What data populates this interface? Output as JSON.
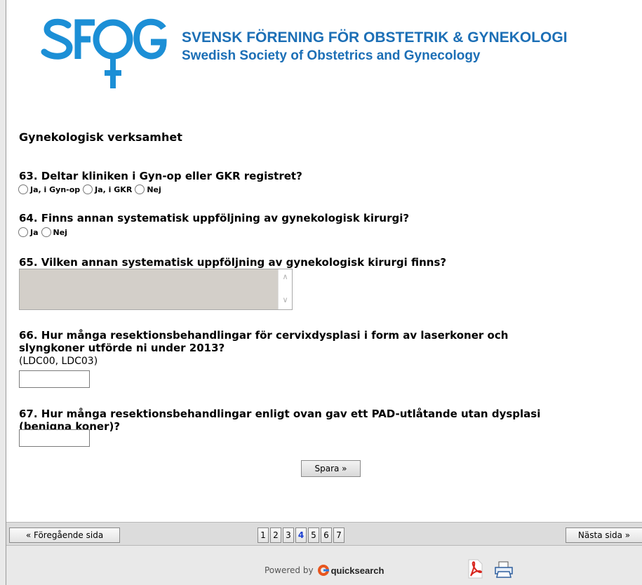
{
  "header": {
    "org_name_sv": "SVENSK FÖRENING FÖR OBSTETRIK & GYNEKOLOGI",
    "org_name_en": "Swedish Society of Obstetrics and Gynecology",
    "logo_icon": "sfog-logo-icon",
    "brand_color": "#1c6fb6"
  },
  "section": {
    "title": "Gynekologisk verksamhet"
  },
  "questions": {
    "q63": {
      "text": "63. Deltar kliniken i Gyn-op eller GKR registret?",
      "options": [
        "Ja, i Gyn-op",
        "Ja, i GKR",
        "Nej"
      ]
    },
    "q64": {
      "text": "64. Finns annan systematisk uppföljning av gynekologisk kirurgi?",
      "options": [
        "Ja",
        "Nej"
      ]
    },
    "q65": {
      "text": "65. Vilken annan systematisk uppföljning av gynekologisk kirurgi finns?",
      "value": ""
    },
    "q66": {
      "line1": "66. Hur många resektionsbehandlingar för cervixdysplasi i form av laserkoner och",
      "line2": "slyngkoner utförde ni under 2013?",
      "hint": "(LDC00, LDC03)",
      "value": ""
    },
    "q67": {
      "line1": "67. Hur många resektionsbehandlingar enligt ovan gav ett PAD-utlåtande utan dysplasi",
      "line2": "(benigna koner)?",
      "value": ""
    }
  },
  "save_label": "Spara »",
  "nav": {
    "prev_label": "« Föregående sida",
    "next_label": "Nästa sida »",
    "pages": [
      "1",
      "2",
      "3",
      "4",
      "5",
      "6",
      "7"
    ],
    "current_page": "4"
  },
  "footer": {
    "powered_by": "Powered by",
    "brand": "quicksearch",
    "icons": [
      "pdf-icon",
      "print-icon"
    ]
  }
}
